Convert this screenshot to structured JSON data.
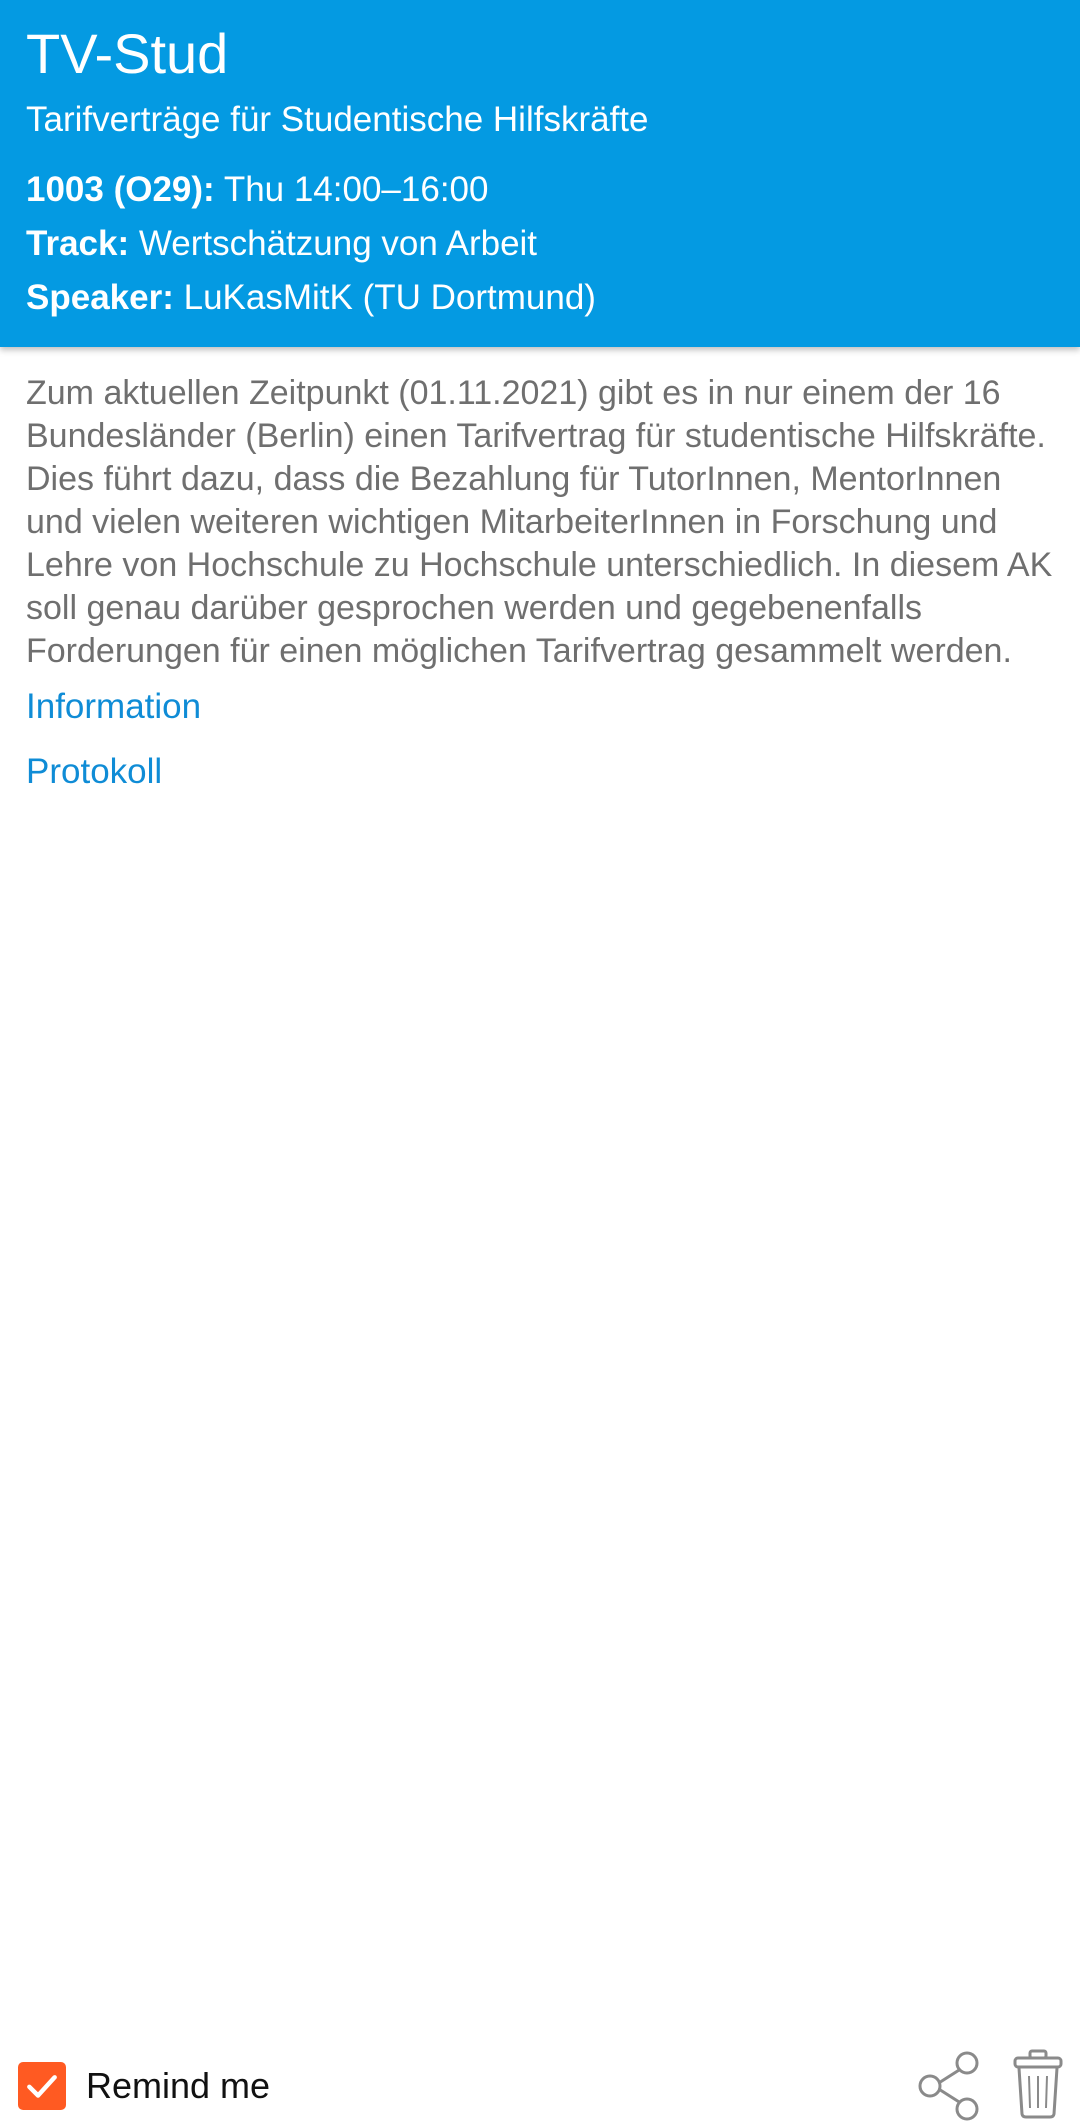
{
  "session": {
    "title": "TV-Stud",
    "subtitle": "Tarifverträge für Studentische Hilfskräfte",
    "room_time": {
      "key": "1003 (O29):",
      "value": "Thu 14:00–16:00"
    },
    "track": {
      "key": "Track:",
      "value": "Wertschätzung von Arbeit"
    },
    "speaker": {
      "key": "Speaker:",
      "value": "LuKasMitK (TU Dortmund)"
    }
  },
  "abstract": "Zum aktuellen Zeitpunkt (01.11.2021) gibt es in nur einem der 16 Bundesländer (Berlin) einen Tarifvertrag für studentische Hilfskräfte. Dies führt dazu, dass die Bezahlung für TutorInnen, MentorInnen und vielen weiteren wichtigen MitarbeiterInnen in Forschung und Lehre von Hochschule zu Hochschule unterschiedlich. In diesem AK soll genau darüber gesprochen werden und gegebenenfalls Forderungen für einen möglichen Tarifvertrag gesammelt werden.",
  "links": {
    "information": "Information",
    "protokoll": "Protokoll"
  },
  "footer": {
    "remind_label": "Remind me",
    "remind_checked": true,
    "icons": {
      "checkbox": "checkmark-icon",
      "share": "share-icon",
      "delete": "trash-icon"
    }
  },
  "colors": {
    "header_bg": "#049ae2",
    "link": "#0f8cd6",
    "checkbox": "#ff5a22",
    "body_text": "#6f6f6f"
  }
}
